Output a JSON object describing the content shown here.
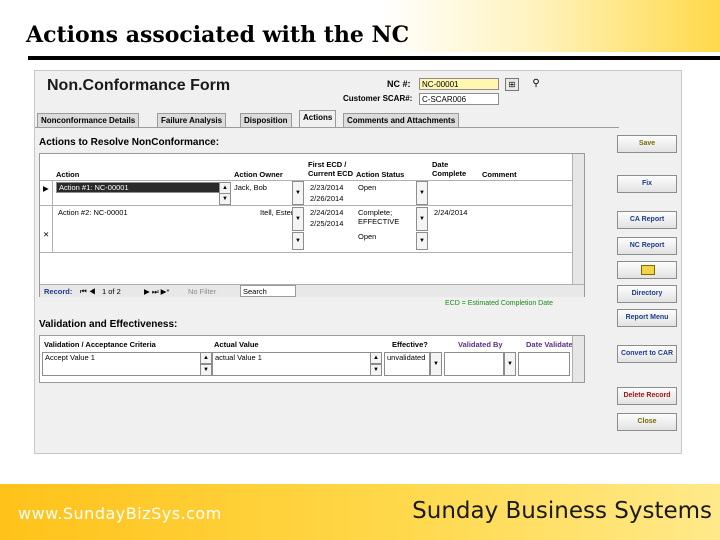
{
  "slide": {
    "title": "Actions associated with the NC",
    "footer_url": "www.SundayBizSys.com",
    "footer_company": "Sunday Business Systems"
  },
  "form": {
    "title": "Non.Conformance Form",
    "nc_label": "NC #:",
    "nc_value": "NC-00001",
    "scar_label": "Customer SCAR#:",
    "scar_value": "C-SCAR006",
    "icons": [
      "calculator-icon",
      "binoculars-icon"
    ],
    "tabs": [
      {
        "label": "Nonconformance Details",
        "active": false
      },
      {
        "label": "Failure Analysis",
        "active": false
      },
      {
        "label": "Disposition",
        "active": false
      },
      {
        "label": "Actions",
        "active": true
      },
      {
        "label": "Comments and Attachments",
        "active": false
      }
    ],
    "actions_section": {
      "title": "Actions to Resolve NonConformance:",
      "columns": {
        "action": "Action",
        "owner": "Action Owner",
        "ecd": "First ECD / Current ECD",
        "status": "Action Status",
        "date_complete": "Date Complete",
        "comment": "Comment"
      },
      "rows": [
        {
          "action": "Action #1: NC-00001",
          "owner": "Jack, Bob",
          "ecd_first": "2/23/2014",
          "ecd_current": "2/26/2014",
          "status": "Open",
          "date_complete": "",
          "selector": "▶"
        },
        {
          "action": "Action #2: NC-00001",
          "owner": "Itell, Ester",
          "ecd_first": "2/24/2014",
          "ecd_current": "2/25/2014",
          "status": "Complete; EFFECTIVE",
          "status_extra": "Open",
          "date_complete": "2/24/2014",
          "selector": "✕"
        }
      ],
      "nav": {
        "record_label": "Record:",
        "record_value": "1 of 2",
        "filter": "No Filter",
        "search": "Search"
      },
      "ecd_note": "ECD = Estimated Completion Date"
    },
    "validation_section": {
      "title": "Validation and Effectiveness:",
      "columns": {
        "criteria": "Validation / Acceptance Criteria",
        "actual": "Actual Value",
        "effective": "Effective?",
        "validated_by": "Validated By",
        "date_validated": "Date Validated"
      },
      "row": {
        "criteria": "Accept Value 1",
        "actual": "actual Value 1",
        "effective": "unvalidated",
        "validated_by": "",
        "date_validated": ""
      }
    },
    "buttons": {
      "save": "Save",
      "fix": "Fix",
      "ca_report": "CA Report",
      "nc_report": "NC Report",
      "directory": "Directory",
      "report_menu": "Report Menu",
      "convert_car": "Convert to CAR",
      "delete_record": "Delete Record",
      "close": "Close"
    },
    "colors": {
      "nc_field_bg": "#fff7b0",
      "ecd_note": "#1a8a1a",
      "purple_header": "#5b2d8a",
      "footer_gold": "#ffc21a"
    }
  }
}
